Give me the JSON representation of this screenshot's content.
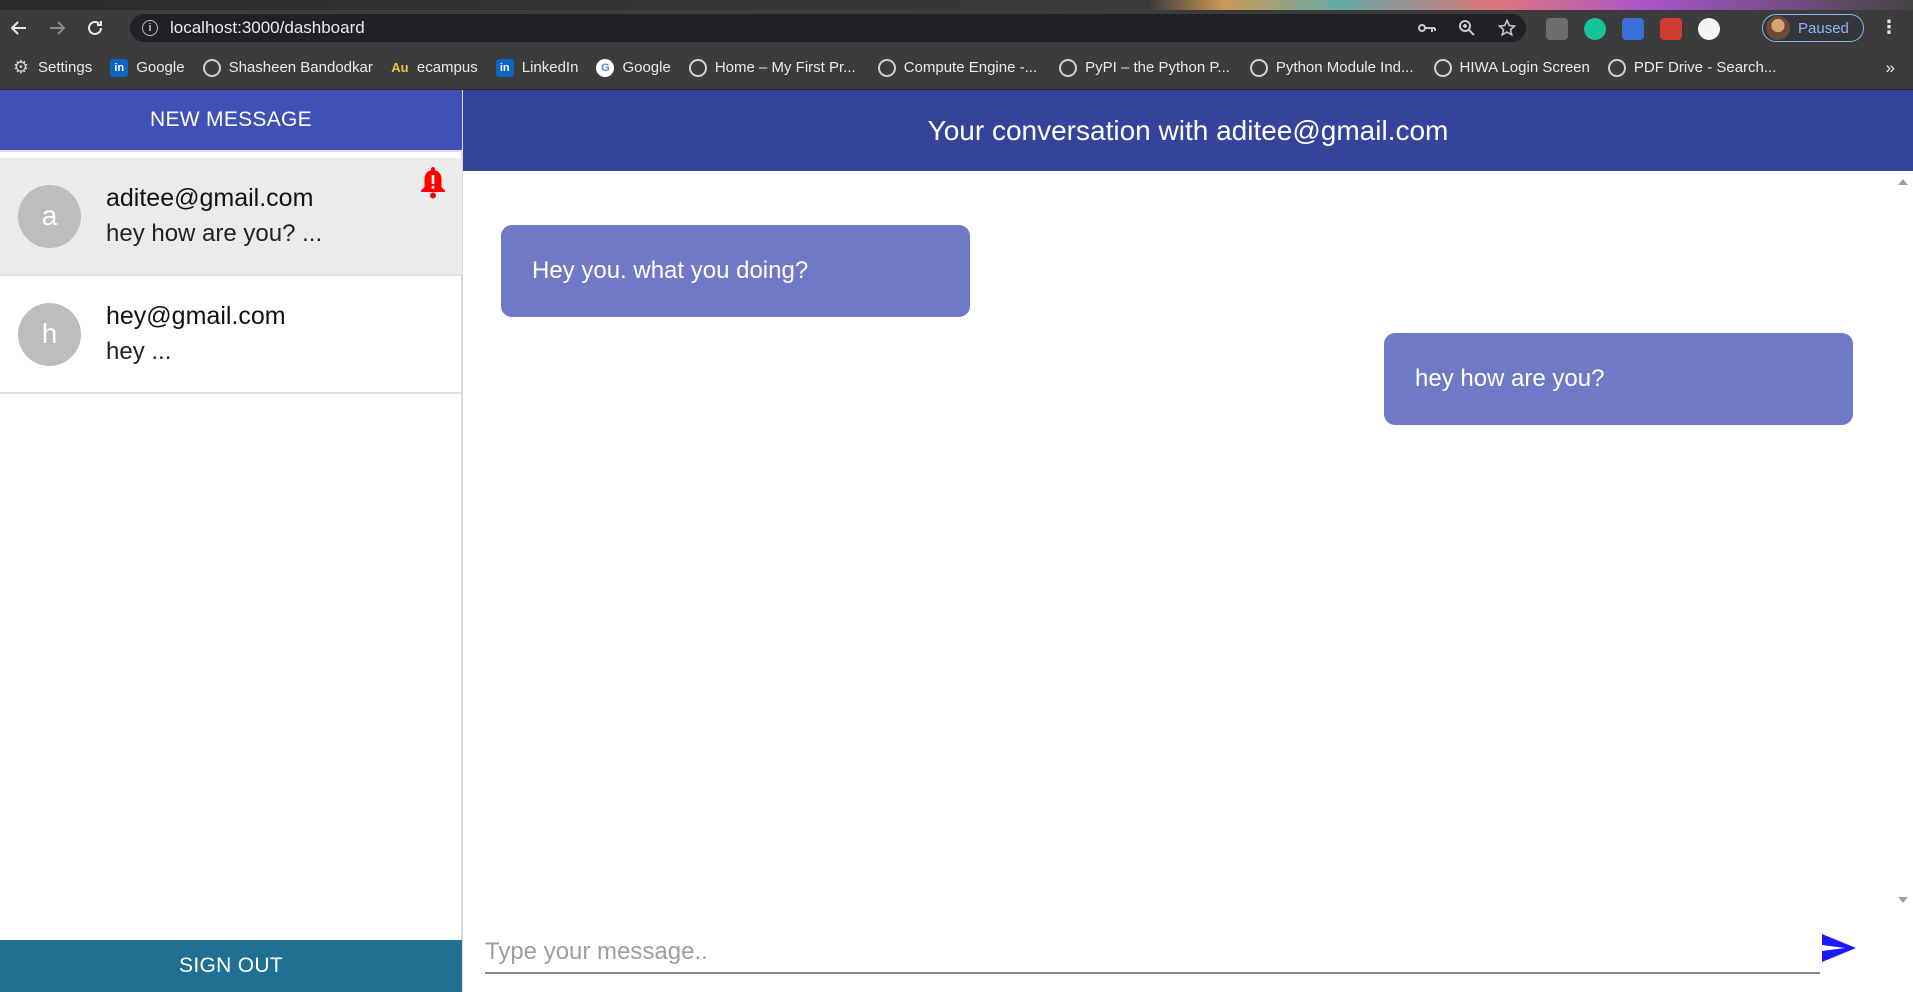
{
  "browser": {
    "url": "localhost:3000/dashboard",
    "profile_label": "Paused",
    "bookmarks": [
      {
        "label": "Settings",
        "icon": "gear-icon"
      },
      {
        "label": "Google",
        "icon": "linkedin-icon"
      },
      {
        "label": "Shasheen Bandodkar",
        "icon": "globe-icon"
      },
      {
        "label": "ecampus",
        "icon": "au-icon"
      },
      {
        "label": "LinkedIn",
        "icon": "linkedin-icon"
      },
      {
        "label": "Google",
        "icon": "google-icon"
      },
      {
        "label": "Home – My First Pr...",
        "icon": "globe-icon"
      },
      {
        "label": "Compute Engine -...",
        "icon": "globe-icon"
      },
      {
        "label": "PyPI – the Python P...",
        "icon": "globe-icon"
      },
      {
        "label": "Python Module Ind...",
        "icon": "globe-icon"
      },
      {
        "label": "HIWA Login Screen",
        "icon": "globe-icon"
      },
      {
        "label": "PDF Drive - Search...",
        "icon": "globe-icon"
      }
    ]
  },
  "sidebar": {
    "new_message_label": "NEW MESSAGE",
    "sign_out_label": "SIGN OUT",
    "chats": [
      {
        "initial": "a",
        "email": "aditee@gmail.com",
        "preview": "hey how are you? ...",
        "unread": true
      },
      {
        "initial": "h",
        "email": "hey@gmail.com",
        "preview": "hey ...",
        "unread": false
      }
    ]
  },
  "conversation": {
    "title": "Your conversation with aditee@gmail.com",
    "messages": [
      {
        "text": "Hey you. what you doing?",
        "side": "left"
      },
      {
        "text": "hey how are you?",
        "side": "right"
      }
    ],
    "input_placeholder": "Type your message..",
    "bubble_color": "#7079c6",
    "header_color": "#35449a"
  },
  "colors": {
    "new_message_bg": "#3f51b5",
    "sign_out_bg": "#1f7093",
    "send_icon": "#1a1aff",
    "bell_icon": "#ff0000"
  }
}
